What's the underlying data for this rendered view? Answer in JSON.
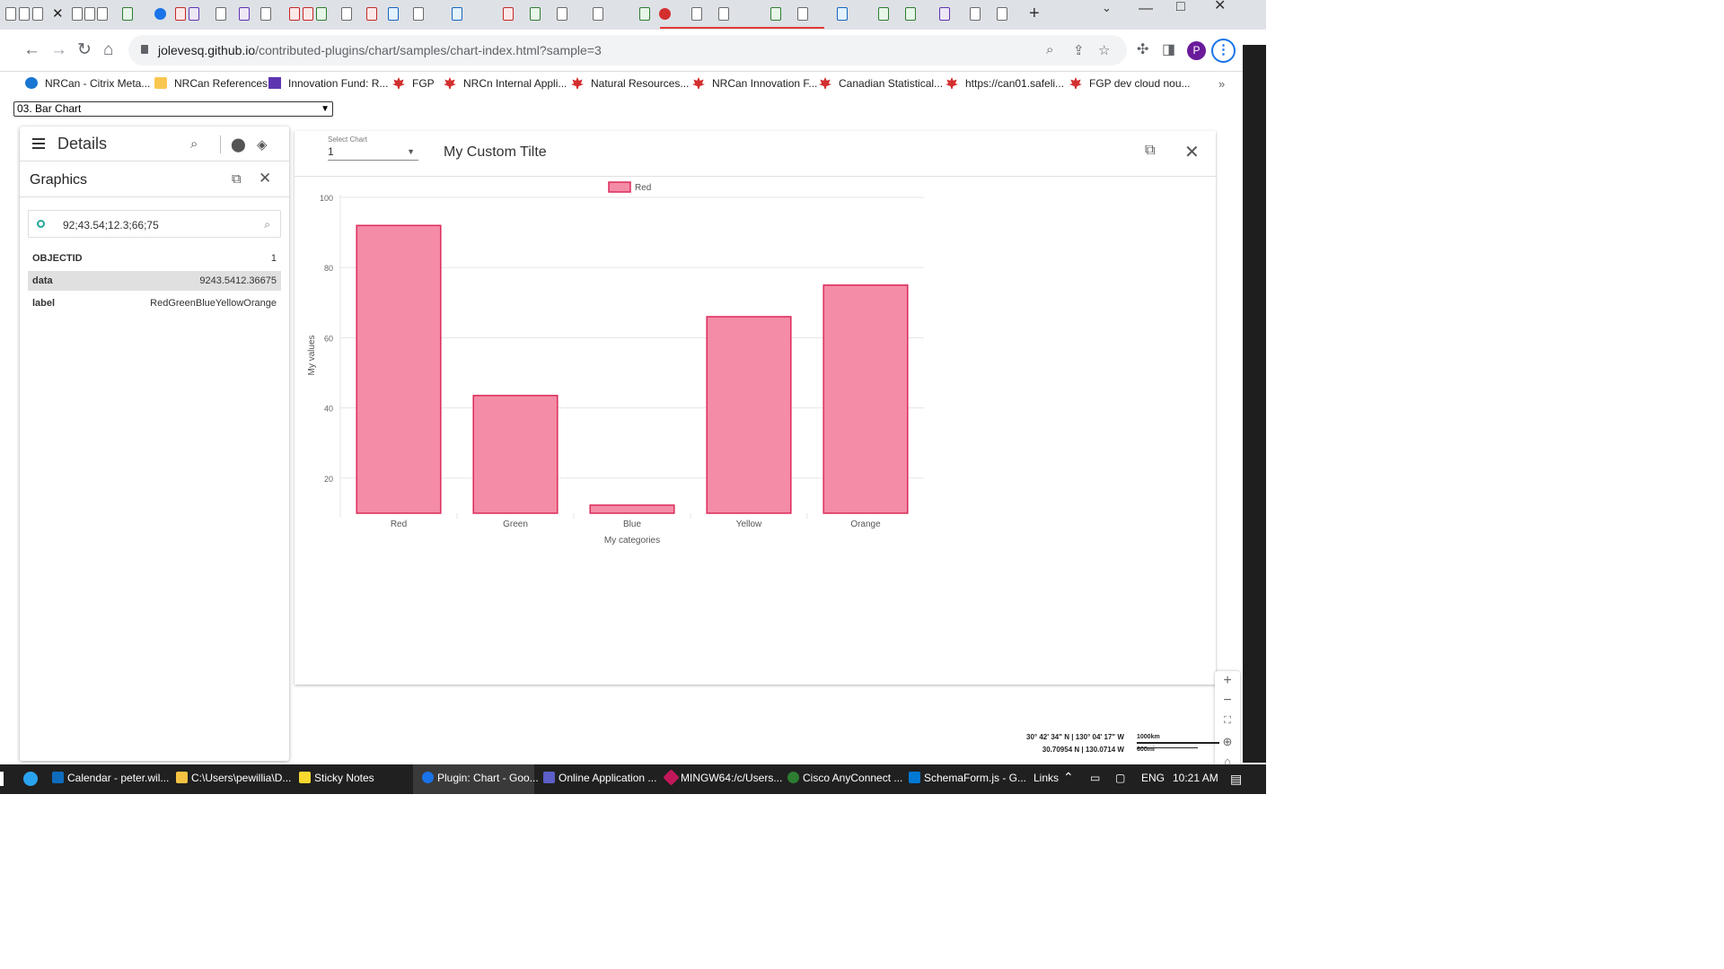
{
  "browser": {
    "url_domain": "jolevesq.github.io",
    "url_path": "/contributed-plugins/chart/samples/chart-index.html?sample=3",
    "avatar_letter": "P",
    "bookmarks": [
      "NRCan - Citrix Meta...",
      "NRCan References",
      "Innovation Fund: R...",
      "FGP",
      "NRCn Internal Appli...",
      "Natural Resources...",
      "NRCan Innovation F...",
      "Canadian Statistical...",
      "https://can01.safeli...",
      "FGP dev cloud nou..."
    ],
    "bookmarks_more": "»"
  },
  "page": {
    "sample_select": "03. Bar Chart",
    "details_title": "Details",
    "graphics_title": "Graphics",
    "search_value": "92;43.54;12.3;66;75",
    "attributes": [
      {
        "key": "OBJECTID",
        "value": "1"
      },
      {
        "key": "data",
        "value": "9243.5412.36675"
      },
      {
        "key": "label",
        "value": "RedGreenBlueYellowOrange"
      }
    ]
  },
  "chart_panel": {
    "select_label": "Select Chart",
    "select_value": "1",
    "title": "My Custom Tilte"
  },
  "chart_data": {
    "type": "bar",
    "categories": [
      "Red",
      "Green",
      "Blue",
      "Yellow",
      "Orange"
    ],
    "series": [
      {
        "name": "Red",
        "values": [
          92,
          43.54,
          12.3,
          66,
          75
        ]
      }
    ],
    "xlabel": "My categories",
    "ylabel": "My values",
    "yticks": [
      20,
      40,
      60,
      80,
      100
    ],
    "ylim": [
      10,
      100
    ],
    "legend": "top-center",
    "bar_fill": "#f48ca6",
    "bar_stroke": "#dc2a5a",
    "grid": true
  },
  "map": {
    "coords_line1": "30° 42' 34\" N | 130° 04' 17\" W",
    "coords_line2": "30.70954 N | 130.0714 W",
    "scale_km": "1000km",
    "scale_mi": "600mi"
  },
  "taskbar": {
    "items": [
      "Calendar - peter.wil...",
      "C:\\Users\\pewillia\\D...",
      "Sticky Notes",
      "Plugin: Chart - Goo...",
      "Online Application ...",
      "MINGW64:/c/Users...",
      "Cisco AnyConnect ...",
      "SchemaForm.js - G..."
    ],
    "links": "Links",
    "lang": "ENG",
    "time": "10:21 AM"
  }
}
